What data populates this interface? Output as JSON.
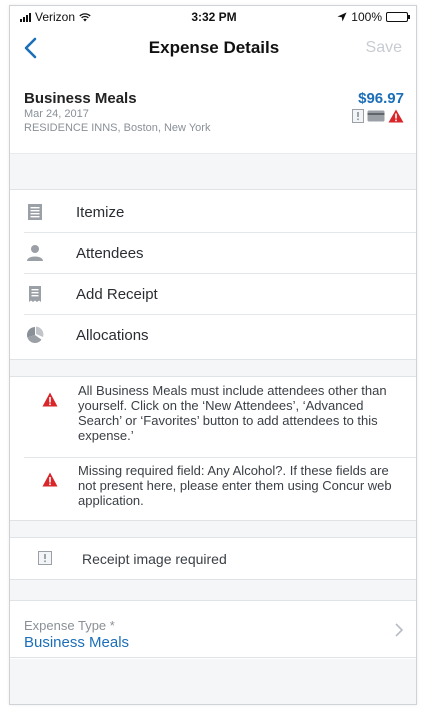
{
  "status_bar": {
    "carrier": "Verizon",
    "time": "3:32 PM",
    "battery": "100%"
  },
  "nav": {
    "title": "Expense Details",
    "save_label": "Save",
    "back_icon": "chevron-left-icon"
  },
  "expense": {
    "name": "Business Meals",
    "date": "Mar 24, 2017",
    "vendor": "RESIDENCE INNS, Boston, New York",
    "amount": "$96.97"
  },
  "menu": {
    "items": [
      {
        "label": "Itemize",
        "icon": "itemize-icon"
      },
      {
        "label": "Attendees",
        "icon": "person-icon"
      },
      {
        "label": "Add Receipt",
        "icon": "receipt-icon"
      },
      {
        "label": "Allocations",
        "icon": "pie-chart-icon"
      }
    ]
  },
  "warnings": [
    "All Business Meals must include attendees other than yourself.  Click on the ‘New Attendees’, ‘Advanced Search’ or ‘Favorites’ button to add attendees to this expense.’",
    "Missing required field: Any Alcohol?. If these fields are not present here, please enter them using Concur web application."
  ],
  "receipt": {
    "label": "Receipt image required"
  },
  "expense_type": {
    "caption": "Expense Type *",
    "value": "Business Meals"
  },
  "colors": {
    "accent": "#1b6fb8",
    "warning": "#d8262a",
    "disabled": "#c8ccd2"
  }
}
